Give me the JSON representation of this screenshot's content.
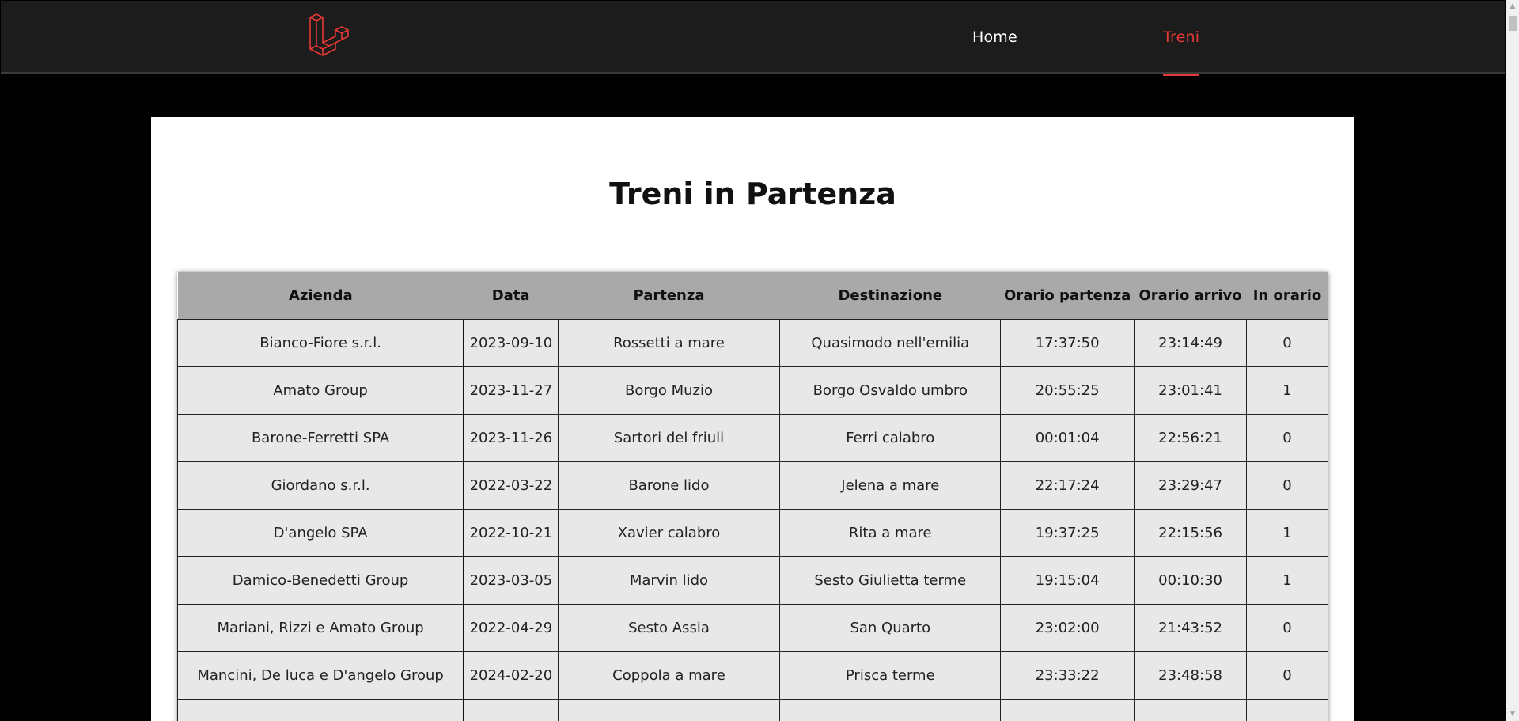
{
  "nav": {
    "items": [
      {
        "label": "Home",
        "active": false
      },
      {
        "label": "Treni",
        "active": true
      }
    ],
    "accent_color": "#e53935",
    "logo_icon": "laravel-logo-icon"
  },
  "main": {
    "title": "Treni in Partenza",
    "table": {
      "headers": [
        "Azienda",
        "Data",
        "Partenza",
        "Destinazione",
        "Orario partenza",
        "Orario arrivo",
        "In orario"
      ],
      "rows": [
        [
          "Bianco-Fiore s.r.l.",
          "2023-09-10",
          "Rossetti a mare",
          "Quasimodo nell'emilia",
          "17:37:50",
          "23:14:49",
          "0"
        ],
        [
          "Amato Group",
          "2023-11-27",
          "Borgo Muzio",
          "Borgo Osvaldo umbro",
          "20:55:25",
          "23:01:41",
          "1"
        ],
        [
          "Barone-Ferretti SPA",
          "2023-11-26",
          "Sartori del friuli",
          "Ferri calabro",
          "00:01:04",
          "22:56:21",
          "0"
        ],
        [
          "Giordano s.r.l.",
          "2022-03-22",
          "Barone lido",
          "Jelena a mare",
          "22:17:24",
          "23:29:47",
          "0"
        ],
        [
          "D'angelo SPA",
          "2022-10-21",
          "Xavier calabro",
          "Rita a mare",
          "19:37:25",
          "22:15:56",
          "1"
        ],
        [
          "Damico-Benedetti Group",
          "2023-03-05",
          "Marvin lido",
          "Sesto Giulietta terme",
          "19:15:04",
          "00:10:30",
          "1"
        ],
        [
          "Mariani, Rizzi e Amato Group",
          "2022-04-29",
          "Sesto Assia",
          "San Quarto",
          "23:02:00",
          "21:43:52",
          "0"
        ],
        [
          "Mancini, De luca e D'angelo Group",
          "2024-02-20",
          "Coppola a mare",
          "Prisca terme",
          "23:33:22",
          "23:48:58",
          "0"
        ],
        [
          "",
          "",
          "",
          "",
          "",
          "",
          ""
        ]
      ]
    }
  }
}
